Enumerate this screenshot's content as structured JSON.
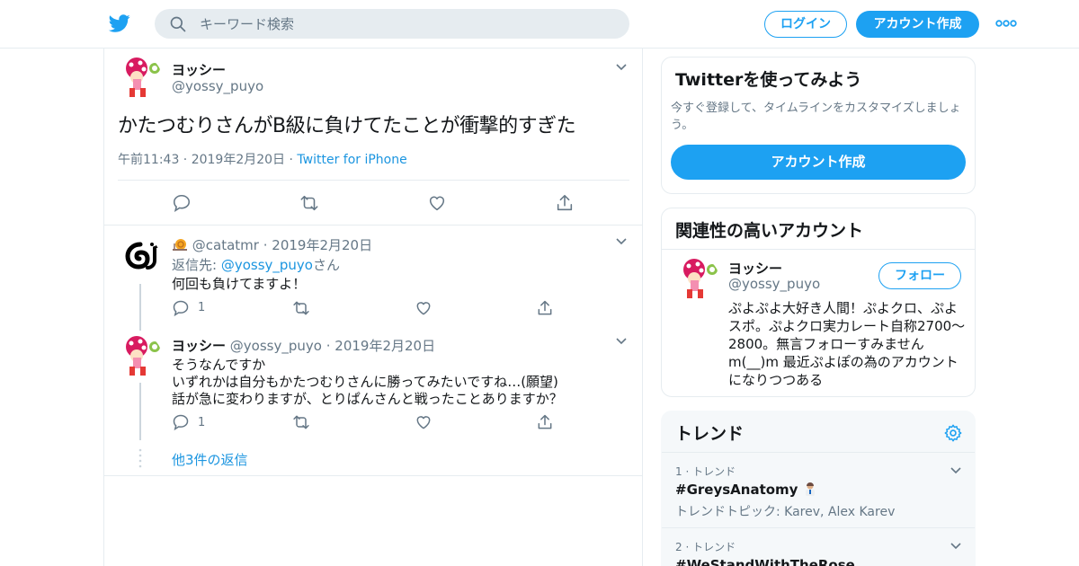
{
  "header": {
    "search_placeholder": "キーワード検索",
    "login_label": "ログイン",
    "signup_label": "アカウント作成"
  },
  "main_tweet": {
    "name": "ヨッシー",
    "handle": "@yossy_puyo",
    "text": "かたつむりさんがB級に負けてたことが衝撃的すぎた",
    "time": "午前11:43 · 2019年2月20日 ·",
    "source": "Twitter for iPhone"
  },
  "replies": [
    {
      "name": "",
      "handle": "@catatmr",
      "date": "· 2019年2月20日",
      "reply_to_prefix": "返信先: ",
      "reply_to_handle": "@yossy_puyo",
      "reply_to_suffix": "さん",
      "text": "何回も負けてますよ！",
      "reply_count": "1"
    },
    {
      "name": "ヨッシー",
      "handle": "@yossy_puyo",
      "date": "· 2019年2月20日",
      "text_line1": "そうなんですか",
      "text_line2": "いずれかは自分もかたつむりさんに勝ってみたいですね…(願望)",
      "text_line3": "話が急に変わりますが、とりぱんさんと戦ったことありますか？",
      "reply_count": "1"
    }
  ],
  "more_replies_label": "他3件の返信",
  "sidebar": {
    "signup_card": {
      "title": "Twitterを使ってみよう",
      "desc_line1": "今すぐ登録して、タイムラインをカスタマイズしましょ",
      "desc_line2": "う。",
      "button_label": "アカウント作成"
    },
    "related_card": {
      "title": "関連性の高いアカウント",
      "name": "ヨッシー",
      "handle": "@yossy_puyo",
      "follow_label": "フォロー",
      "bio_line1": "ぷよぷよ大好き人間！ぷよクロ、ぷよ",
      "bio_line2": "スポ。ぷよクロ実力レート自称2700〜",
      "bio_line3": "2800。無言フォローすみません",
      "bio_line4": "m(__)m 最近ぷよぽの為のアカウント",
      "bio_line5": "になりつつある"
    },
    "trends": {
      "title": "トレンド",
      "items": [
        {
          "rank": "1 · トレンド",
          "name": "#GreysAnatomy",
          "topics": "トレンドトピック: Karev, Alex Karev"
        },
        {
          "rank": "2 · トレンド",
          "name": "#WeStandWithTheRose"
        }
      ]
    }
  },
  "colors": {
    "accent": "#1da1f2",
    "link": "#1b95e0",
    "muted": "#657786",
    "border": "#e6ecf0"
  }
}
